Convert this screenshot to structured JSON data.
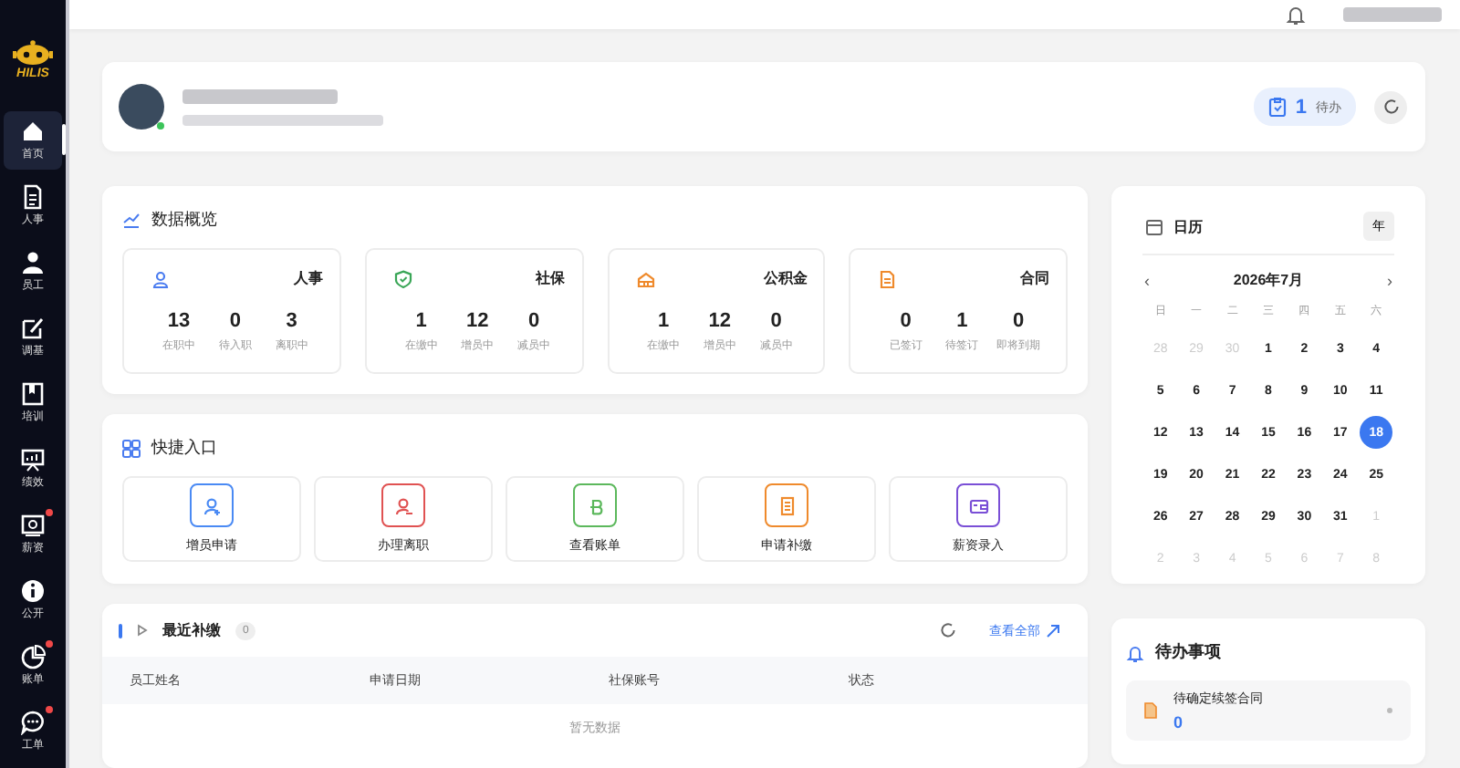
{
  "sidebar": {
    "logo": "HILIS",
    "items": [
      {
        "label": "首页",
        "selected": true,
        "badge": false
      },
      {
        "label": "人事",
        "selected": false,
        "badge": false
      },
      {
        "label": "员工",
        "selected": false,
        "badge": false
      },
      {
        "label": "调基",
        "selected": false,
        "badge": false
      },
      {
        "label": "培训",
        "selected": false,
        "badge": false
      },
      {
        "label": "绩效",
        "selected": false,
        "badge": false
      },
      {
        "label": "薪资",
        "selected": false,
        "badge": true
      },
      {
        "label": "公开",
        "selected": false,
        "badge": false
      },
      {
        "label": "账单",
        "selected": false,
        "badge": true
      },
      {
        "label": "工单",
        "selected": false,
        "badge": true
      }
    ]
  },
  "profile": {
    "online": true,
    "pending": {
      "count": "1",
      "label": "待办"
    }
  },
  "overview": {
    "title": "数据概览",
    "cards": [
      {
        "kind": "people",
        "title": "人事",
        "metrics": [
          {
            "value": "13",
            "label": "在职中"
          },
          {
            "value": "0",
            "label": "待入职"
          },
          {
            "value": "3",
            "label": "离职中"
          }
        ]
      },
      {
        "kind": "shield",
        "title": "社保",
        "metrics": [
          {
            "value": "1",
            "label": "在缴中"
          },
          {
            "value": "12",
            "label": "增员中"
          },
          {
            "value": "0",
            "label": "减员中"
          }
        ]
      },
      {
        "kind": "fund",
        "title": "公积金",
        "metrics": [
          {
            "value": "1",
            "label": "在缴中"
          },
          {
            "value": "12",
            "label": "增员中"
          },
          {
            "value": "0",
            "label": "减员中"
          }
        ]
      },
      {
        "kind": "contract",
        "title": "合同",
        "metrics": [
          {
            "value": "0",
            "label": "已签订"
          },
          {
            "value": "1",
            "label": "待签订"
          },
          {
            "value": "0",
            "label": "即将到期"
          }
        ]
      }
    ]
  },
  "shortcuts": {
    "title": "快捷入口",
    "items": [
      {
        "kind": "add",
        "label": "增员申请"
      },
      {
        "kind": "leave",
        "label": "办理离职"
      },
      {
        "kind": "bill",
        "label": "查看账单"
      },
      {
        "kind": "supplement",
        "label": "申请补缴"
      },
      {
        "kind": "salary",
        "label": "薪资录入"
      }
    ]
  },
  "recent": {
    "title": "最近补缴",
    "count": "0",
    "view_all": "查看全部",
    "columns": [
      "员工姓名",
      "申请日期",
      "社保账号",
      "状态"
    ],
    "empty": "暂无数据"
  },
  "calendar": {
    "title": "日历",
    "view_button": "年",
    "prev": "‹",
    "next": "›",
    "month": "2026年7月",
    "weekdays": [
      "日",
      "一",
      "二",
      "三",
      "四",
      "五",
      "六"
    ],
    "days": [
      {
        "day": "28",
        "outside": true,
        "selected": false
      },
      {
        "day": "29",
        "outside": true,
        "selected": false
      },
      {
        "day": "30",
        "outside": true,
        "selected": false
      },
      {
        "day": "1",
        "outside": false,
        "selected": false
      },
      {
        "day": "2",
        "outside": false,
        "selected": false
      },
      {
        "day": "3",
        "outside": false,
        "selected": false
      },
      {
        "day": "4",
        "outside": false,
        "selected": false
      },
      {
        "day": "5",
        "outside": false,
        "selected": false
      },
      {
        "day": "6",
        "outside": false,
        "selected": false
      },
      {
        "day": "7",
        "outside": false,
        "selected": false
      },
      {
        "day": "8",
        "outside": false,
        "selected": false
      },
      {
        "day": "9",
        "outside": false,
        "selected": false
      },
      {
        "day": "10",
        "outside": false,
        "selected": false
      },
      {
        "day": "11",
        "outside": false,
        "selected": false
      },
      {
        "day": "12",
        "outside": false,
        "selected": false
      },
      {
        "day": "13",
        "outside": false,
        "selected": false
      },
      {
        "day": "14",
        "outside": false,
        "selected": false
      },
      {
        "day": "15",
        "outside": false,
        "selected": false
      },
      {
        "day": "16",
        "outside": false,
        "selected": false
      },
      {
        "day": "17",
        "outside": false,
        "selected": false
      },
      {
        "day": "18",
        "outside": false,
        "selected": true
      },
      {
        "day": "19",
        "outside": false,
        "selected": false
      },
      {
        "day": "20",
        "outside": false,
        "selected": false
      },
      {
        "day": "21",
        "outside": false,
        "selected": false
      },
      {
        "day": "22",
        "outside": false,
        "selected": false
      },
      {
        "day": "23",
        "outside": false,
        "selected": false
      },
      {
        "day": "24",
        "outside": false,
        "selected": false
      },
      {
        "day": "25",
        "outside": false,
        "selected": false
      },
      {
        "day": "26",
        "outside": false,
        "selected": false
      },
      {
        "day": "27",
        "outside": false,
        "selected": false
      },
      {
        "day": "28",
        "outside": false,
        "selected": false
      },
      {
        "day": "29",
        "outside": false,
        "selected": false
      },
      {
        "day": "30",
        "outside": false,
        "selected": false
      },
      {
        "day": "31",
        "outside": false,
        "selected": false
      },
      {
        "day": "1",
        "outside": true,
        "selected": false
      },
      {
        "day": "2",
        "outside": true,
        "selected": false
      },
      {
        "day": "3",
        "outside": true,
        "selected": false
      },
      {
        "day": "4",
        "outside": true,
        "selected": false
      },
      {
        "day": "5",
        "outside": true,
        "selected": false
      },
      {
        "day": "6",
        "outside": true,
        "selected": false
      },
      {
        "day": "7",
        "outside": true,
        "selected": false
      },
      {
        "day": "8",
        "outside": true,
        "selected": false
      }
    ]
  },
  "todo": {
    "title": "待办事项",
    "items": [
      {
        "title": "待确定续签合同",
        "count": "0"
      }
    ]
  }
}
